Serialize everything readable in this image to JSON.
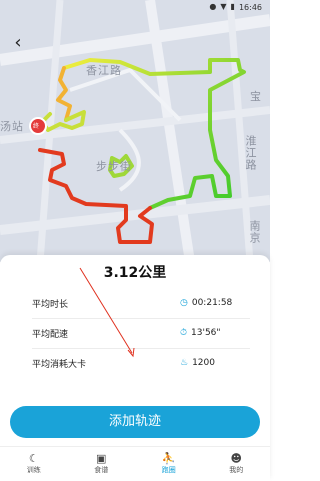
{
  "status_bar": {
    "time": "16:46"
  },
  "map": {
    "labels": [
      "香江路",
      "宝",
      "淮江路",
      "南京",
      "步步街",
      "汤站"
    ],
    "start_marker": "终"
  },
  "summary": {
    "distance": "3.12公里",
    "stats": [
      {
        "label": "平均时长",
        "icon": "clock-icon",
        "value": "00:21:58"
      },
      {
        "label": "平均配速",
        "icon": "timer-icon",
        "value": "13'56\""
      },
      {
        "label": "平均消耗大卡",
        "icon": "fire-icon",
        "value": "1200"
      }
    ]
  },
  "add_button": {
    "label": "添加轨迹"
  },
  "tabs": [
    {
      "label": "训练",
      "icon": "moon-icon"
    },
    {
      "label": "食谱",
      "icon": "book-icon"
    },
    {
      "label": "跑圈",
      "icon": "runner-icon"
    },
    {
      "label": "我的",
      "icon": "person-icon"
    }
  ],
  "colors": {
    "accent": "#1aa3d8",
    "route_green": "#55d12b",
    "route_red": "#e23a1e"
  }
}
